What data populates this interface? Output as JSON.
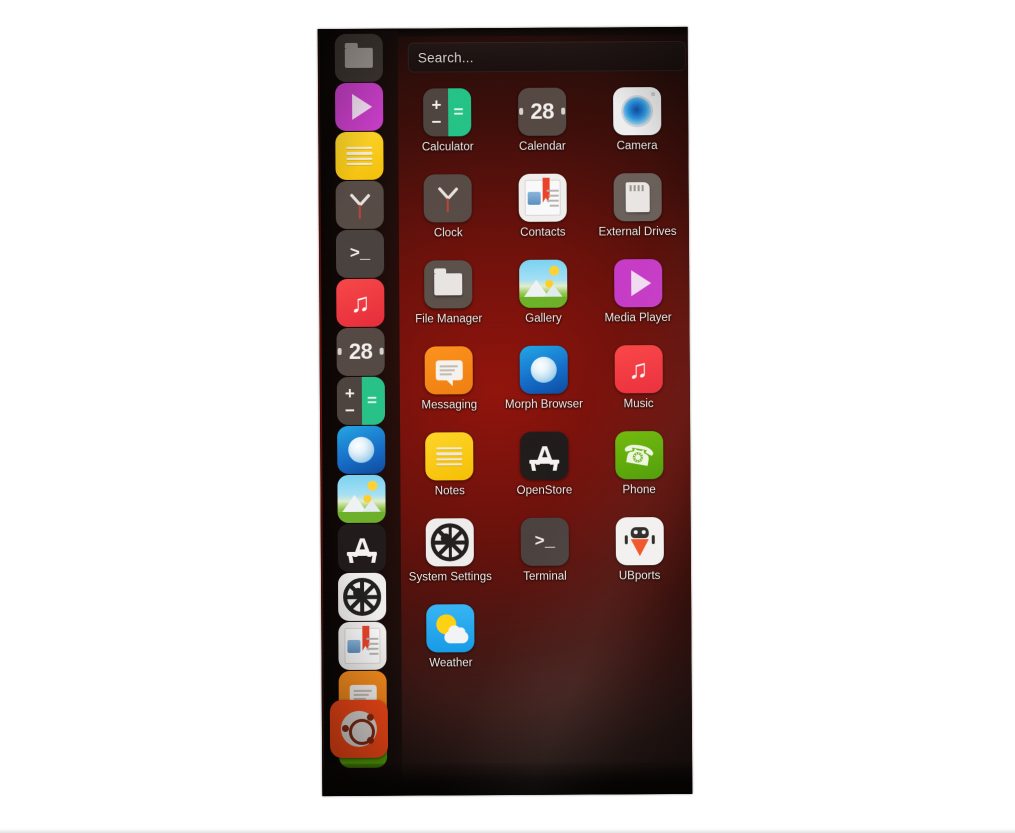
{
  "device": {
    "os": "Ubuntu Touch",
    "screen": "app-drawer"
  },
  "search": {
    "placeholder": "Search..."
  },
  "launcher": {
    "items": [
      {
        "label": "File Manager",
        "icon": "folder-icon",
        "style": "ic-folder-generic"
      },
      {
        "label": "Media Player",
        "icon": "play-triangle-icon",
        "style": "ic-mediaplayer"
      },
      {
        "label": "Notes",
        "icon": "notes-lines-icon",
        "style": "ic-notes"
      },
      {
        "label": "Clock",
        "icon": "clock-icon",
        "style": "ic-clock"
      },
      {
        "label": "Terminal",
        "icon": "terminal-prompt-icon",
        "style": "ic-terminal"
      },
      {
        "label": "Music",
        "icon": "music-note-icon",
        "style": "ic-music"
      },
      {
        "label": "Calendar",
        "icon": "calendar-28-icon",
        "style": "ic-calendar"
      },
      {
        "label": "Calculator",
        "icon": "calculator-icon",
        "style": "ic-calculator"
      },
      {
        "label": "Morph Browser",
        "icon": "globe-icon",
        "style": "ic-morph"
      },
      {
        "label": "Gallery",
        "icon": "photo-landscape-icon",
        "style": "ic-gallery"
      },
      {
        "label": "OpenStore",
        "icon": "openstore-a-icon",
        "style": "ic-openstore"
      },
      {
        "label": "System Settings",
        "icon": "gear-icon",
        "style": "ic-settings"
      },
      {
        "label": "Contacts",
        "icon": "contact-card-icon",
        "style": "ic-contacts"
      },
      {
        "label": "Messaging",
        "icon": "speech-bubble-icon",
        "style": "ic-messaging"
      },
      {
        "label": "Phone",
        "icon": "handset-icon",
        "style": "ic-phone"
      }
    ],
    "ubuntu_button": {
      "label": "Ubuntu",
      "icon": "ubuntu-circle-of-friends-icon"
    }
  },
  "apps": [
    {
      "label": "Calculator",
      "icon": "calculator-icon",
      "style": "ic-calculator"
    },
    {
      "label": "Calendar",
      "icon": "calendar-28-icon",
      "style": "ic-calendar",
      "day": "28"
    },
    {
      "label": "Camera",
      "icon": "camera-lens-icon",
      "style": "ic-camera"
    },
    {
      "label": "Clock",
      "icon": "clock-icon",
      "style": "ic-clock"
    },
    {
      "label": "Contacts",
      "icon": "contact-card-icon",
      "style": "ic-contacts"
    },
    {
      "label": "External Drives",
      "icon": "sd-card-icon",
      "style": "ic-sdcard"
    },
    {
      "label": "File Manager",
      "icon": "folder-icon",
      "style": "ic-filemanager"
    },
    {
      "label": "Gallery",
      "icon": "photo-landscape-icon",
      "style": "ic-gallery"
    },
    {
      "label": "Media Player",
      "icon": "play-triangle-icon",
      "style": "ic-mediaplayer"
    },
    {
      "label": "Messaging",
      "icon": "speech-bubble-icon",
      "style": "ic-messaging"
    },
    {
      "label": "Morph Browser",
      "icon": "globe-icon",
      "style": "ic-morph"
    },
    {
      "label": "Music",
      "icon": "music-note-icon",
      "style": "ic-music"
    },
    {
      "label": "Notes",
      "icon": "notes-lines-icon",
      "style": "ic-notes"
    },
    {
      "label": "OpenStore",
      "icon": "openstore-a-icon",
      "style": "ic-openstore"
    },
    {
      "label": "Phone",
      "icon": "handset-icon",
      "style": "ic-phone"
    },
    {
      "label": "System Settings",
      "icon": "gear-icon",
      "style": "ic-settings"
    },
    {
      "label": "Terminal",
      "icon": "terminal-prompt-icon",
      "style": "ic-terminal"
    },
    {
      "label": "UBports",
      "icon": "ubports-robot-icon",
      "style": "ic-ubports"
    },
    {
      "label": "Weather",
      "icon": "sun-cloud-icon",
      "style": "ic-weather"
    }
  ],
  "glyphs": {
    "plus": "+",
    "minus": "−",
    "equals": "=",
    "music_note": "♫",
    "handset": "☎",
    "prompt": ">_",
    "letter_a": "A"
  },
  "colors": {
    "wallpaper_red": "#4a160e",
    "ubuntu_orange": "#e8491c",
    "calculator_green": "#2ec089",
    "messaging_orange": "#f79327",
    "music_red": "#e02e3c",
    "phone_green": "#4f9a0c",
    "notes_yellow": "#f2c012",
    "media_magenta": "#c03fc0",
    "weather_blue": "#1f9ae0",
    "morph_blue": "#1b6fc4"
  }
}
